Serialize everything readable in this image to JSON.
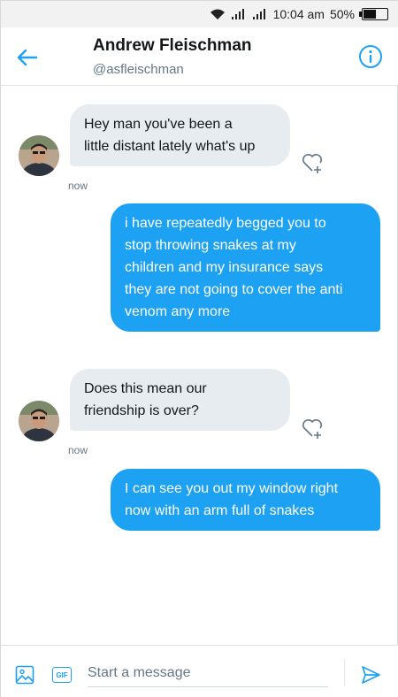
{
  "status_bar": {
    "time": "10:04 am",
    "battery": "50%",
    "battery_level": 0.5
  },
  "header": {
    "name": "Andrew Fleischman",
    "handle": "@asfleischman"
  },
  "messages": [
    {
      "direction": "in",
      "text": "Hey man you've been a\nlittle distant lately what's up",
      "timestamp": "now"
    },
    {
      "direction": "out",
      "text": "i have repeatedly begged you to\nstop throwing snakes at my\nchildren and my insurance says\nthey are not going to cover the anti\nvenom any more"
    },
    {
      "direction": "in",
      "text": "Does this mean our\nfriendship is over?",
      "timestamp": "now"
    },
    {
      "direction": "out",
      "text": "I can see you out my window right\nnow with an arm full of snakes"
    }
  ],
  "composer": {
    "placeholder": "Start a message",
    "gif_label": "GIF"
  },
  "icons": {
    "back": "arrow-left-icon",
    "info": "info-icon",
    "like": "heart-plus-icon",
    "media": "image-icon",
    "gif": "gif-icon",
    "send": "send-icon"
  },
  "colors": {
    "accent": "#1da1f2",
    "incoming_bubble": "#e6ecf0",
    "muted": "#657786"
  }
}
